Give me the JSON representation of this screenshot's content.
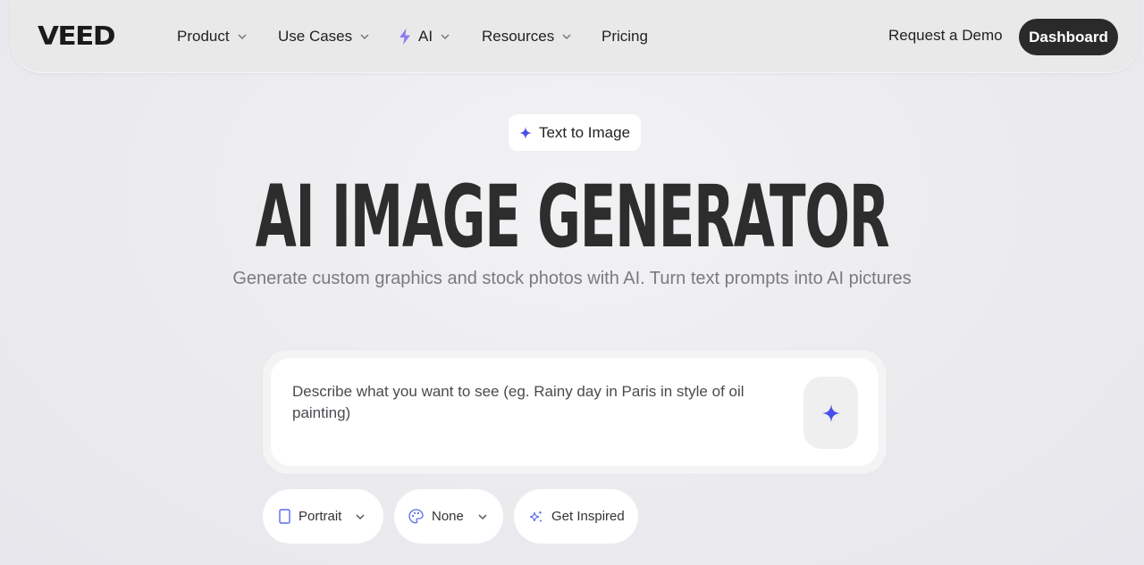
{
  "nav": {
    "logo": "VEED",
    "items": [
      {
        "label": "Product",
        "has_menu": true
      },
      {
        "label": "Use Cases",
        "has_menu": true
      },
      {
        "label": "AI",
        "has_menu": true,
        "icon": "lightning-bolt-icon"
      },
      {
        "label": "Resources",
        "has_menu": true
      },
      {
        "label": "Pricing",
        "has_menu": false
      }
    ],
    "request_demo": "Request a Demo",
    "dashboard": "Dashboard"
  },
  "hero": {
    "badge": "Text to Image",
    "title": "AI IMAGE GENERATOR",
    "subtitle": "Generate custom graphics and stock photos with AI. Turn text prompts into AI pictures"
  },
  "prompt": {
    "placeholder": "Describe what you want to see (eg. Rainy day in Paris in style of oil painting)",
    "value": ""
  },
  "options": {
    "orientation": "Portrait",
    "style": "None",
    "inspire": "Get Inspired"
  },
  "colors": {
    "accent": "#4b4ee8",
    "ai_bolt": "#8b7cf0",
    "dark_button": "#2a2a2a"
  }
}
